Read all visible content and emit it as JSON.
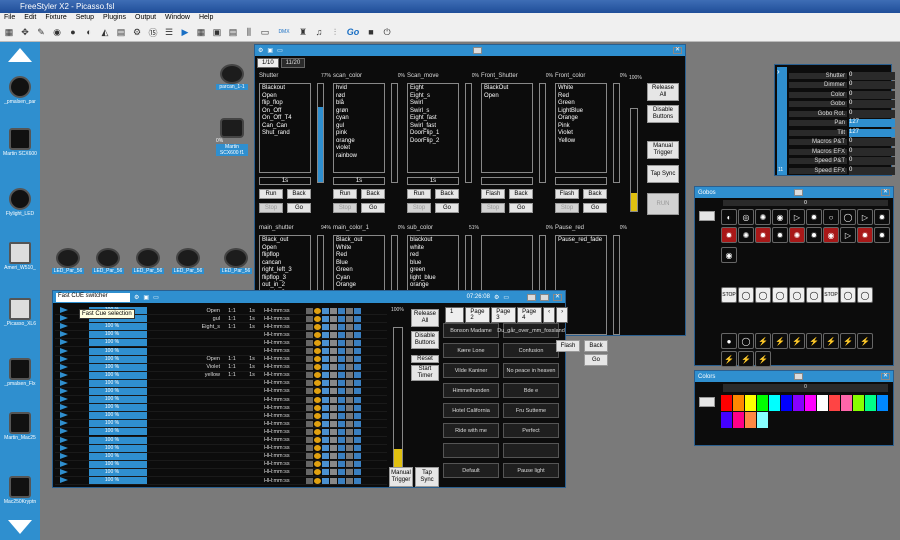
{
  "app": {
    "title": "FreeStyler X2 - Picasso.fsl",
    "menu": [
      "File",
      "Edit",
      "Fixture",
      "Setup",
      "Plugins",
      "Output",
      "Window",
      "Help"
    ],
    "toolbar_go": "Go",
    "toolbar_dmx": "DMX"
  },
  "leftbar": {
    "items": [
      "_pmalsen_par",
      "Martin SCX600",
      "Flylight_LED",
      "Ameri_W510_",
      "_Picasso_XL6",
      "_pmalsen_Flx",
      "Martin_Mac25",
      "Mac250Kryptn"
    ]
  },
  "fixtures": {
    "parcan": "parcan_1-1",
    "martin": "Martin SCX600 f1",
    "martin_pct": "0%",
    "led_pars": [
      "LED_Par_56",
      "LED_Par_56",
      "LED_Par_56",
      "LED_Par_56",
      "LED_Par_56"
    ]
  },
  "sequencer": {
    "tabs": [
      "1/10",
      "11/20"
    ],
    "top_cols": [
      {
        "name": "Shutter",
        "items": [
          "Blackout",
          "Open",
          "flip_flop",
          "On_Off",
          "On_Off_T4",
          "Can_Can",
          "Shut_rand"
        ],
        "pct": "77%",
        "fill": 0.77,
        "time": "1s",
        "btn1": "Run",
        "btn2": "Back",
        "btn3": "Stop",
        "btn4": "Go"
      },
      {
        "name": "scan_color",
        "items": [
          "hvid",
          "rød",
          "blå",
          "grøn",
          "cyan",
          "gul",
          "pink",
          "orange",
          "violet",
          "rainbow"
        ],
        "pct": "0%",
        "fill": 0,
        "time": "1s",
        "btn1": "Run",
        "btn2": "Back",
        "btn3": "Stop",
        "btn4": "Go"
      },
      {
        "name": "Scan_move",
        "items": [
          "Eight",
          "Eight_s",
          "Swirl",
          "Swirl_s",
          "Eight_fast",
          "Swirl_fast",
          "DoorFlip_1",
          "DoorFlip_2"
        ],
        "pct": "0%",
        "fill": 0,
        "time": "1s",
        "btn1": "Run",
        "btn2": "Back",
        "btn3": "Stop",
        "btn4": "Go"
      },
      {
        "name": "Front_Shutter",
        "items": [
          "BlackOut",
          "Open"
        ],
        "pct": "0%",
        "fill": 0,
        "time": "",
        "btn1": "Flash",
        "btn2": "Back",
        "btn3": "Stop",
        "btn4": "Go"
      },
      {
        "name": "Front_color",
        "items": [
          "White",
          "Red",
          "Green",
          "LightBlue",
          "Orange",
          "Pink",
          "Violet",
          "Yellow"
        ],
        "pct": "0%",
        "fill": 0,
        "time": "",
        "btn1": "Flash",
        "btn2": "Back",
        "btn3": "Stop",
        "btn4": "Go"
      }
    ],
    "master_pct": "100%",
    "bottom_cols": [
      {
        "name": "main_shutter",
        "items": [
          "Black_out",
          "Open",
          "flipflop",
          "cancan",
          "right_left_3",
          "flipflop_3",
          "out_in_2",
          "out_in_3"
        ],
        "pct": "94%"
      },
      {
        "name": "main_color_1",
        "items": [
          "Black_out",
          "White",
          "Red",
          "Blue",
          "Green",
          "Cyan",
          "Orange"
        ],
        "pct": "0%"
      },
      {
        "name": "sub_color",
        "items": [
          "blackout",
          "white",
          "red",
          "blue",
          "green",
          "light_blue",
          "orange"
        ],
        "pct": "51%"
      },
      {
        "name": "",
        "items": [],
        "pct": "0%"
      },
      {
        "name": "Pause_red",
        "items": [
          "Pause_red_fade"
        ],
        "pct": "0%"
      }
    ],
    "release_all": "Release All",
    "disable_buttons": "Disable Buttons",
    "manual_trigger": "Manual Trigger",
    "tap_sync": "Tap Sync",
    "run": "RUN",
    "bottom_btn1": "Flash",
    "bottom_btn2": "Back",
    "bottom_btn4": "Go"
  },
  "channels": {
    "rows": [
      {
        "name": "Shutter",
        "value": "0"
      },
      {
        "name": "Dimmer",
        "value": "0"
      },
      {
        "name": "Color",
        "value": "0"
      },
      {
        "name": "Gobo",
        "value": "0"
      },
      {
        "name": "Gobo Rot.",
        "value": "0"
      },
      {
        "name": "Pan",
        "value": "127"
      },
      {
        "name": "Tilt",
        "value": "127"
      },
      {
        "name": "Macros P&T",
        "value": "0"
      },
      {
        "name": "Macros EFX",
        "value": "0"
      },
      {
        "name": "Speed P&T",
        "value": "0"
      },
      {
        "name": "Speed EFX",
        "value": "0"
      }
    ],
    "page": "11"
  },
  "gobos": {
    "title": "Gobos",
    "slider_value": "0",
    "row3_labels": [
      "STOP",
      "STOP"
    ]
  },
  "colors": {
    "title": "Colors",
    "slider_value": "0",
    "swatches": [
      "#ff0000",
      "#ff8800",
      "#ffff00",
      "#00ff00",
      "#00ffff",
      "#0000ff",
      "#8800ff",
      "#ff00ff",
      "#ffffff",
      "#ff4444",
      "#ff66aa",
      "#88ff00",
      "#00ff88",
      "#0088ff",
      "#4400ff",
      "#ff0088",
      "#ff8844",
      "#88ffff"
    ]
  },
  "cuelist": {
    "dropdown": "Fast CUE switcher",
    "time": "07:26:08",
    "tooltip": "Fast Cue selection",
    "rows": [
      {
        "pct": "100 %",
        "name": "Open",
        "a": "1:1",
        "b": "1s",
        "t": "HH:mm:ss"
      },
      {
        "pct": "100 %",
        "name": "gul",
        "a": "1:1",
        "b": "1s",
        "t": "HH:mm:ss"
      },
      {
        "pct": "100 %",
        "name": "Eight_s",
        "a": "1:1",
        "b": "1s",
        "t": "HH:mm:ss"
      },
      {
        "pct": "100 %",
        "name": "",
        "a": "",
        "b": "",
        "t": "HH:mm:ss"
      },
      {
        "pct": "100 %",
        "name": "",
        "a": "",
        "b": "",
        "t": "HH:mm:ss"
      },
      {
        "pct": "100 %",
        "name": "",
        "a": "",
        "b": "",
        "t": "HH:mm:ss"
      },
      {
        "pct": "100 %",
        "name": "Open",
        "a": "1:1",
        "b": "1s",
        "t": "HH:mm:ss"
      },
      {
        "pct": "100 %",
        "name": "Violet",
        "a": "1:1",
        "b": "1s",
        "t": "HH:mm:ss"
      },
      {
        "pct": "100 %",
        "name": "yellow",
        "a": "1:1",
        "b": "1s",
        "t": "HH:mm:ss"
      },
      {
        "pct": "100 %",
        "name": "",
        "a": "",
        "b": "",
        "t": "HH:mm:ss"
      },
      {
        "pct": "100 %",
        "name": "",
        "a": "",
        "b": "",
        "t": "HH:mm:ss"
      },
      {
        "pct": "100 %",
        "name": "",
        "a": "",
        "b": "",
        "t": "HH:mm:ss"
      },
      {
        "pct": "100 %",
        "name": "",
        "a": "",
        "b": "",
        "t": "HH:mm:ss"
      },
      {
        "pct": "100 %",
        "name": "",
        "a": "",
        "b": "",
        "t": "HH:mm:ss"
      },
      {
        "pct": "100 %",
        "name": "",
        "a": "",
        "b": "",
        "t": "HH:mm:ss"
      },
      {
        "pct": "100 %",
        "name": "",
        "a": "",
        "b": "",
        "t": "HH:mm:ss"
      },
      {
        "pct": "100 %",
        "name": "",
        "a": "",
        "b": "",
        "t": "HH:mm:ss"
      },
      {
        "pct": "100 %",
        "name": "",
        "a": "",
        "b": "",
        "t": "HH:mm:ss"
      },
      {
        "pct": "100 %",
        "name": "",
        "a": "",
        "b": "",
        "t": "HH:mm:ss"
      },
      {
        "pct": "100 %",
        "name": "",
        "a": "",
        "b": "",
        "t": "HH:mm:ss"
      },
      {
        "pct": "100 %",
        "name": "",
        "a": "",
        "b": "",
        "t": "HH:mm:ss"
      },
      {
        "pct": "100 %",
        "name": "",
        "a": "",
        "b": "",
        "t": "HH:mm:ss"
      }
    ],
    "master_pct": "100%",
    "release_all": "Release All",
    "disable_buttons": "Disable Buttons",
    "reset": "Reset",
    "start_timer": "Start Timer",
    "manual_trigger": "Manual Trigger",
    "tap_sync": "Tap Sync",
    "page_input": "1",
    "pages": [
      "Page 2",
      "Page 3",
      "Page 4"
    ],
    "songs": [
      "Bonson Madame",
      "Du_går_over_mm_fossland",
      "Kære Lone",
      "Confusion",
      "Vilde Kaniner",
      "No peace in heaven",
      "Himmelhunden",
      "Bde e",
      "Hotel California",
      "Fru Sutteme",
      "Ride with me",
      "Perfect",
      "",
      "",
      "Default",
      "Pause light"
    ]
  }
}
